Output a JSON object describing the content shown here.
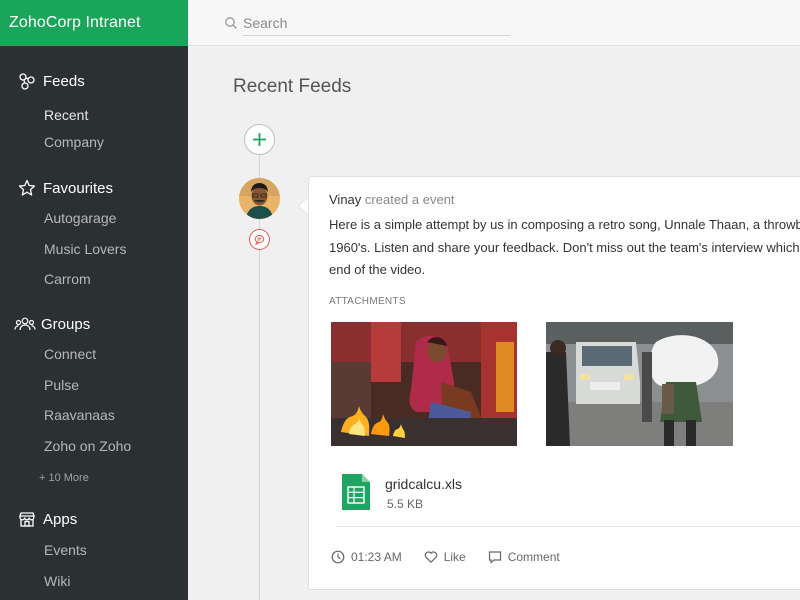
{
  "app": {
    "brand": "ZohoCorp Intranet"
  },
  "search": {
    "placeholder": "Search"
  },
  "sidebar": {
    "feeds": {
      "label": "Feeds",
      "items": [
        "Recent",
        "Company"
      ]
    },
    "favourites": {
      "label": "Favourites",
      "items": [
        "Autogarage",
        "Music Lovers",
        "Carrom"
      ]
    },
    "groups": {
      "label": "Groups",
      "items": [
        "Connect",
        "Pulse",
        "Raavanaas",
        "Zoho on Zoho"
      ],
      "more": "+ 10 More"
    },
    "apps": {
      "label": "Apps",
      "items": [
        "Events",
        "Wiki"
      ]
    }
  },
  "main": {
    "title": "Recent Feeds",
    "post": {
      "author": "Vinay",
      "action": "created a event",
      "text_lines": [
        "Here is a simple attempt by us in composing a retro song, Unnale Thaan, a throwback",
        "1960's. Listen and share your feedback. Don't miss out the team's interview which is",
        "end of the video."
      ],
      "attachments_label": "ATTACHMENTS",
      "file": {
        "name": "gridcalcu.xls",
        "size": "5.5 KB"
      },
      "time": "01:23 AM",
      "like_label": "Like",
      "comment_label": "Comment"
    }
  },
  "colors": {
    "brand_green": "#19a65a",
    "sidebar_bg": "#2b3033",
    "marker_red": "#e25b4d"
  },
  "icons": [
    "search-icon",
    "feeds-icon",
    "star-icon",
    "groups-icon",
    "apps-store-icon",
    "plus-icon",
    "chat-icon",
    "spreadsheet-icon",
    "clock-icon",
    "heart-icon",
    "comment-icon"
  ]
}
